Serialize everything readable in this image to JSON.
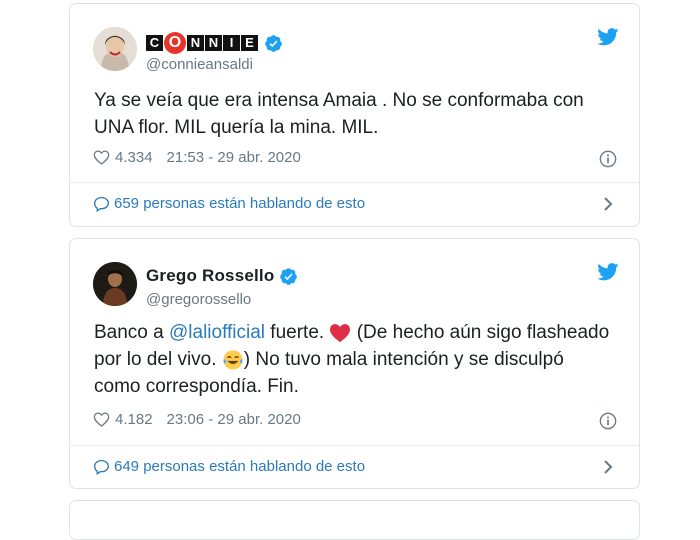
{
  "tweets": [
    {
      "name_letters": [
        "C",
        "O",
        "N",
        "N",
        "I",
        "E"
      ],
      "handle": "@connieansaldi",
      "text": "Ya se veía que era intensa Amaia . No se conformaba con UNA flor. MIL quería la mina. MIL.",
      "likes": "4.334",
      "datetime": "21:53 - 29 abr. 2020",
      "conversation": "659 personas están hablando de esto"
    },
    {
      "name": "Grego Rossello",
      "handle": "@gregorossello",
      "text_before": "Banco a ",
      "mention": "@laliofficial",
      "text_mid": " fuerte. ",
      "text_after_heart": " (De hecho aún sigo flasheado por lo del vivo. ",
      "text_end": ") No tuvo mala intención y se disculpó como correspondía. Fin.",
      "likes": "4.182",
      "datetime": "23:06 - 29 abr. 2020",
      "conversation": "649 personas están hablando de esto"
    }
  ],
  "colors": {
    "accent": "#1da1f2",
    "link": "#2b7bb9",
    "muted": "#697882",
    "heart": "#e0245e"
  },
  "icons": [
    "twitter-bird-icon",
    "verified-badge-icon",
    "heart-icon",
    "info-icon",
    "speech-bubble-icon",
    "chevron-right-icon",
    "red-heart-emoji",
    "tears-of-joy-emoji"
  ]
}
